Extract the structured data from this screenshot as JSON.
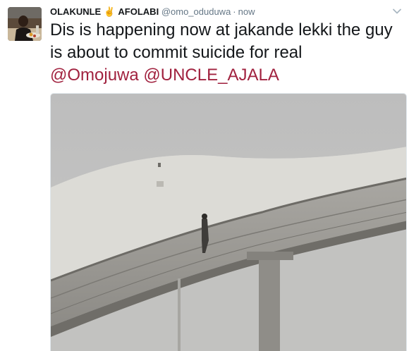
{
  "tweet": {
    "display_name": "OLAKUNLE",
    "emoji": "✌",
    "display_name_2": "AFOLABI",
    "handle": "@omo_oduduwa",
    "separator": "·",
    "time": "now",
    "text_parts": [
      "Dis is happening now at jakande lekki the guy is about to commit suicide for real"
    ],
    "mentions": [
      "@Omojuwa",
      "@UNCLE_AJALA"
    ]
  },
  "icons": {
    "avatar": "user-avatar-photo",
    "menu": "chevron-down-icon",
    "emoji": "victory-hand-emoji"
  },
  "colors": {
    "mention": "#a1223f",
    "text": "#14171a",
    "meta": "#657786"
  }
}
